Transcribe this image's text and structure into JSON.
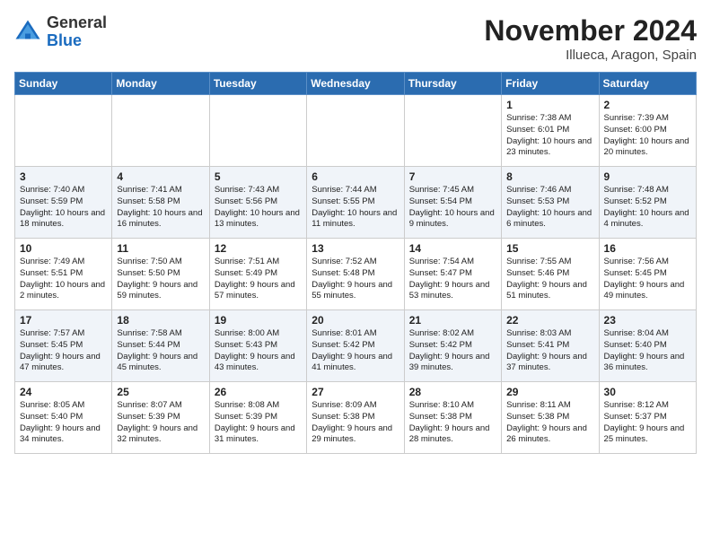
{
  "header": {
    "logo_line1": "General",
    "logo_line2": "Blue",
    "month_title": "November 2024",
    "location": "Illueca, Aragon, Spain"
  },
  "days_of_week": [
    "Sunday",
    "Monday",
    "Tuesday",
    "Wednesday",
    "Thursday",
    "Friday",
    "Saturday"
  ],
  "weeks": [
    [
      {
        "day": "",
        "info": ""
      },
      {
        "day": "",
        "info": ""
      },
      {
        "day": "",
        "info": ""
      },
      {
        "day": "",
        "info": ""
      },
      {
        "day": "",
        "info": ""
      },
      {
        "day": "1",
        "info": "Sunrise: 7:38 AM\nSunset: 6:01 PM\nDaylight: 10 hours and 23 minutes."
      },
      {
        "day": "2",
        "info": "Sunrise: 7:39 AM\nSunset: 6:00 PM\nDaylight: 10 hours and 20 minutes."
      }
    ],
    [
      {
        "day": "3",
        "info": "Sunrise: 7:40 AM\nSunset: 5:59 PM\nDaylight: 10 hours and 18 minutes."
      },
      {
        "day": "4",
        "info": "Sunrise: 7:41 AM\nSunset: 5:58 PM\nDaylight: 10 hours and 16 minutes."
      },
      {
        "day": "5",
        "info": "Sunrise: 7:43 AM\nSunset: 5:56 PM\nDaylight: 10 hours and 13 minutes."
      },
      {
        "day": "6",
        "info": "Sunrise: 7:44 AM\nSunset: 5:55 PM\nDaylight: 10 hours and 11 minutes."
      },
      {
        "day": "7",
        "info": "Sunrise: 7:45 AM\nSunset: 5:54 PM\nDaylight: 10 hours and 9 minutes."
      },
      {
        "day": "8",
        "info": "Sunrise: 7:46 AM\nSunset: 5:53 PM\nDaylight: 10 hours and 6 minutes."
      },
      {
        "day": "9",
        "info": "Sunrise: 7:48 AM\nSunset: 5:52 PM\nDaylight: 10 hours and 4 minutes."
      }
    ],
    [
      {
        "day": "10",
        "info": "Sunrise: 7:49 AM\nSunset: 5:51 PM\nDaylight: 10 hours and 2 minutes."
      },
      {
        "day": "11",
        "info": "Sunrise: 7:50 AM\nSunset: 5:50 PM\nDaylight: 9 hours and 59 minutes."
      },
      {
        "day": "12",
        "info": "Sunrise: 7:51 AM\nSunset: 5:49 PM\nDaylight: 9 hours and 57 minutes."
      },
      {
        "day": "13",
        "info": "Sunrise: 7:52 AM\nSunset: 5:48 PM\nDaylight: 9 hours and 55 minutes."
      },
      {
        "day": "14",
        "info": "Sunrise: 7:54 AM\nSunset: 5:47 PM\nDaylight: 9 hours and 53 minutes."
      },
      {
        "day": "15",
        "info": "Sunrise: 7:55 AM\nSunset: 5:46 PM\nDaylight: 9 hours and 51 minutes."
      },
      {
        "day": "16",
        "info": "Sunrise: 7:56 AM\nSunset: 5:45 PM\nDaylight: 9 hours and 49 minutes."
      }
    ],
    [
      {
        "day": "17",
        "info": "Sunrise: 7:57 AM\nSunset: 5:45 PM\nDaylight: 9 hours and 47 minutes."
      },
      {
        "day": "18",
        "info": "Sunrise: 7:58 AM\nSunset: 5:44 PM\nDaylight: 9 hours and 45 minutes."
      },
      {
        "day": "19",
        "info": "Sunrise: 8:00 AM\nSunset: 5:43 PM\nDaylight: 9 hours and 43 minutes."
      },
      {
        "day": "20",
        "info": "Sunrise: 8:01 AM\nSunset: 5:42 PM\nDaylight: 9 hours and 41 minutes."
      },
      {
        "day": "21",
        "info": "Sunrise: 8:02 AM\nSunset: 5:42 PM\nDaylight: 9 hours and 39 minutes."
      },
      {
        "day": "22",
        "info": "Sunrise: 8:03 AM\nSunset: 5:41 PM\nDaylight: 9 hours and 37 minutes."
      },
      {
        "day": "23",
        "info": "Sunrise: 8:04 AM\nSunset: 5:40 PM\nDaylight: 9 hours and 36 minutes."
      }
    ],
    [
      {
        "day": "24",
        "info": "Sunrise: 8:05 AM\nSunset: 5:40 PM\nDaylight: 9 hours and 34 minutes."
      },
      {
        "day": "25",
        "info": "Sunrise: 8:07 AM\nSunset: 5:39 PM\nDaylight: 9 hours and 32 minutes."
      },
      {
        "day": "26",
        "info": "Sunrise: 8:08 AM\nSunset: 5:39 PM\nDaylight: 9 hours and 31 minutes."
      },
      {
        "day": "27",
        "info": "Sunrise: 8:09 AM\nSunset: 5:38 PM\nDaylight: 9 hours and 29 minutes."
      },
      {
        "day": "28",
        "info": "Sunrise: 8:10 AM\nSunset: 5:38 PM\nDaylight: 9 hours and 28 minutes."
      },
      {
        "day": "29",
        "info": "Sunrise: 8:11 AM\nSunset: 5:38 PM\nDaylight: 9 hours and 26 minutes."
      },
      {
        "day": "30",
        "info": "Sunrise: 8:12 AM\nSunset: 5:37 PM\nDaylight: 9 hours and 25 minutes."
      }
    ]
  ]
}
